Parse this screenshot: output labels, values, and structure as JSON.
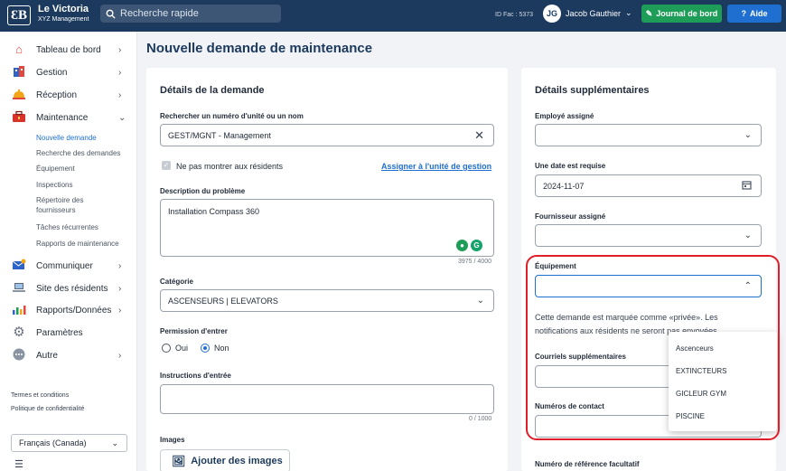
{
  "topbar": {
    "logo": "ƐB",
    "brand_name": "Le Victoria",
    "brand_sub": "XYZ Management",
    "search_placeholder": "Recherche rapide",
    "id_fac": "ID Fac : 5373",
    "avatar_initials": "JG",
    "user_name": "Jacob Gauthier",
    "journal_label": "Journal de bord",
    "aide_label": "Aide"
  },
  "sidebar": {
    "items": [
      {
        "label": "Tableau de bord",
        "icon": "house-icon"
      },
      {
        "label": "Gestion",
        "icon": "building-icon"
      },
      {
        "label": "Réception",
        "icon": "bell-icon"
      },
      {
        "label": "Maintenance",
        "icon": "toolbox-icon"
      },
      {
        "label": "Communiquer",
        "icon": "envelope-icon"
      },
      {
        "label": "Site des résidents",
        "icon": "laptop-icon"
      },
      {
        "label": "Rapports/Données",
        "icon": "bar-chart-icon"
      },
      {
        "label": "Paramètres",
        "icon": "gear-icon"
      },
      {
        "label": "Autre",
        "icon": "more-icon"
      }
    ],
    "maintenance_sub": [
      "Nouvelle demande",
      "Recherche des demandes",
      "Équipement",
      "Inspections",
      "Répertoire des fournisseurs",
      "Tâches récurrentes",
      "Rapports de maintenance"
    ],
    "terms": "Termes et conditions",
    "privacy": "Politique de confidentialité",
    "language": "Français (Canada)"
  },
  "page": {
    "title": "Nouvelle demande de maintenance"
  },
  "details": {
    "title": "Détails de la demande",
    "unit_label": "Rechercher un numéro d'unité ou un nom",
    "unit_value": "GEST/MGNT - Management",
    "residents_checkbox": "Ne pas montrer aux résidents",
    "assign_link": "Assigner à l'unité de gestion",
    "problem_label": "Description du problème",
    "problem_value": "Installation Compass 360",
    "problem_count": "3975 / 4000",
    "category_label": "Catégorie",
    "category_value": "ASCENSEURS | ELEVATORS",
    "permission_label": "Permission d'entrer",
    "permission_yes": "Oui",
    "permission_no": "Non",
    "entry_label": "Instructions d'entrée",
    "entry_count": "0 / 1000",
    "images_label": "Images",
    "add_images": "Ajouter des images"
  },
  "extra": {
    "title": "Détails supplémentaires",
    "employee_label": "Employé assigné",
    "date_label": "Une date est requise",
    "date_value": "2024-11-07",
    "supplier_label": "Fournisseur assigné",
    "equipment_label": "Équipement",
    "private_notice": "Cette demande est marquée comme «privée». Les notifications aux résidents ne seront pas envoyées",
    "emails_label": "Courriels supplémentaires",
    "contact_label": "Numéros de contact",
    "reference_label": "Numéro de référence facultatif",
    "equipment_options": [
      "Ascenceurs",
      "EXTINCTEURS",
      "GICLEUR GYM",
      "PISCINE"
    ]
  },
  "colors": {
    "topbar": "#1c3a5e",
    "journal": "#1d9d58",
    "aide": "#1f6fd1",
    "highlight": "#e01e2a"
  }
}
